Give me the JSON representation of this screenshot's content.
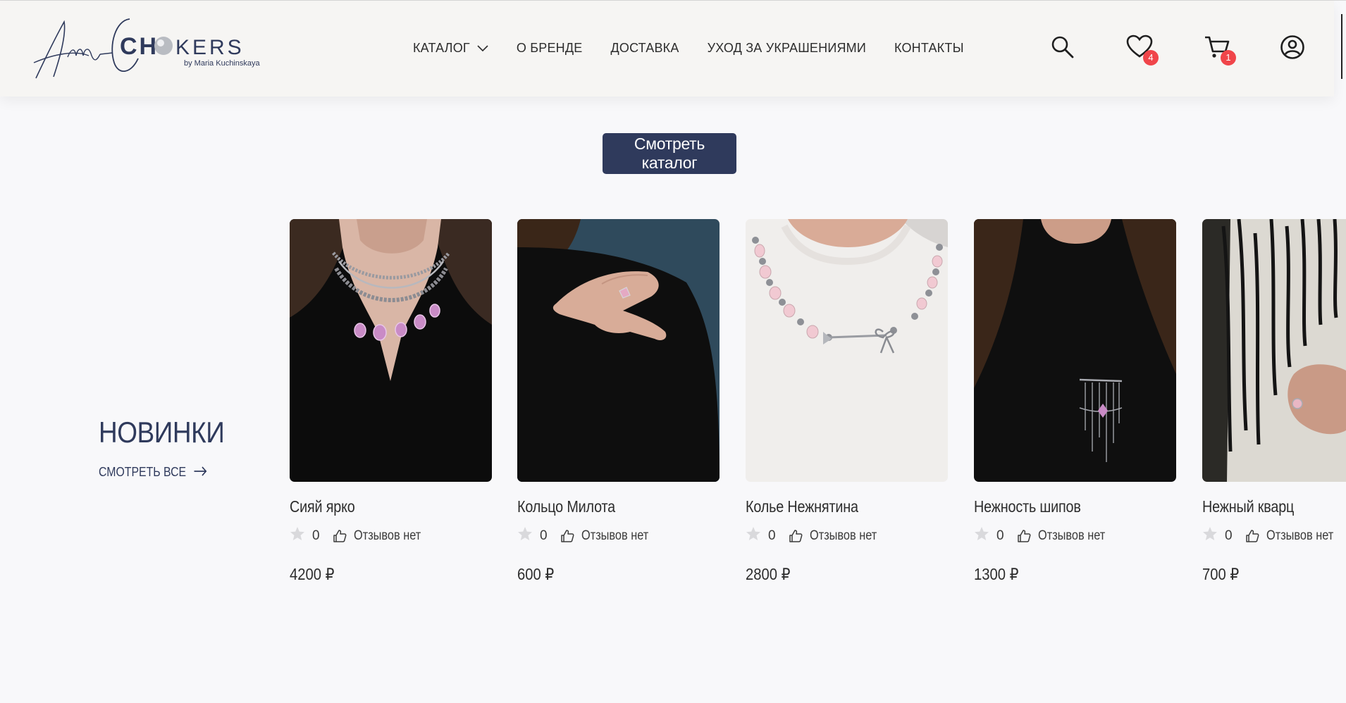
{
  "brand": {
    "logo_script": "Am-",
    "logo_word": "CH",
    "logo_word_rest": "KERS",
    "logo_sub": "by Maria Kuchinskaya"
  },
  "nav": {
    "items": [
      {
        "label": "КАТАЛОГ",
        "has_dropdown": true
      },
      {
        "label": "О БРЕНДЕ"
      },
      {
        "label": "ДОСТАВКА"
      },
      {
        "label": "УХОД ЗА УКРАШЕНИЯМИ"
      },
      {
        "label": "КОНТАКТЫ"
      }
    ]
  },
  "header_icons": {
    "search": "search-icon",
    "wishlist": {
      "icon": "heart-icon",
      "count": "4"
    },
    "cart": {
      "icon": "cart-icon",
      "count": "1"
    },
    "account": "user-icon"
  },
  "cta": {
    "label": "Смотреть каталог"
  },
  "section": {
    "title": "НОВИНКИ",
    "see_all": "СМОТРЕТЬ ВСЕ"
  },
  "products": [
    {
      "name": "Сияй ярко",
      "rating": "0",
      "reviews": "Отзывов нет",
      "price": "4200 ₽"
    },
    {
      "name": "Кольцо Милота",
      "rating": "0",
      "reviews": "Отзывов нет",
      "price": "600 ₽"
    },
    {
      "name": "Колье Нежнятина",
      "rating": "0",
      "reviews": "Отзывов нет",
      "price": "2800 ₽"
    },
    {
      "name": "Нежность шипов",
      "rating": "0",
      "reviews": "Отзывов нет",
      "price": "1300 ₽"
    },
    {
      "name": "Нежный кварц",
      "rating": "0",
      "reviews": "Отзывов нет",
      "price": "700 ₽"
    }
  ],
  "colors": {
    "accent": "#2f3a5c",
    "badge": "#f0454a",
    "header_bg": "#f6f5f3",
    "page_bg": "#f8f8fa"
  }
}
